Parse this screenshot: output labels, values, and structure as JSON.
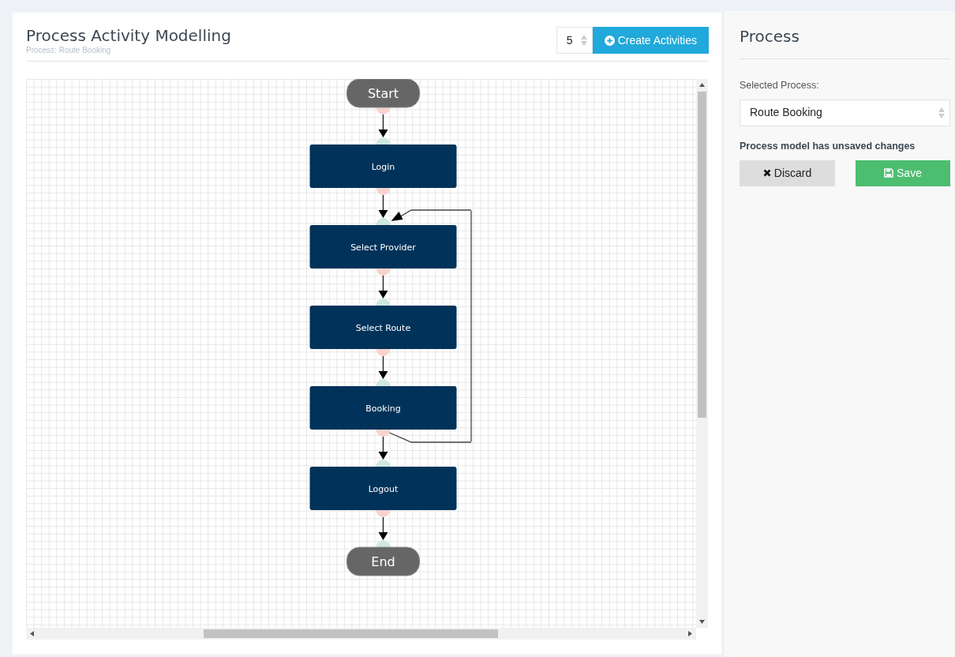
{
  "header": {
    "title": "Process Activity Modelling",
    "subtitle": "Process: Route Booking"
  },
  "toolbar": {
    "count": "5",
    "create_button": "Create Activities"
  },
  "diagram": {
    "nodes": [
      {
        "kind": "start",
        "label": "Start",
        "loop_source": false,
        "loop_target": false
      },
      {
        "kind": "activity",
        "label": "Login",
        "loop_source": false,
        "loop_target": false
      },
      {
        "kind": "activity",
        "label": "Select Provider",
        "loop_source": false,
        "loop_target": true
      },
      {
        "kind": "activity",
        "label": "Select Route",
        "loop_source": false,
        "loop_target": false
      },
      {
        "kind": "activity",
        "label": "Booking",
        "loop_source": true,
        "loop_target": false
      },
      {
        "kind": "activity",
        "label": "Logout",
        "loop_source": false,
        "loop_target": false
      },
      {
        "kind": "end",
        "label": "End",
        "loop_source": false,
        "loop_target": false
      }
    ]
  },
  "sidebar": {
    "title": "Process",
    "select_label": "Selected Process:",
    "selected_process": "Route Booking",
    "notice": "Process model has unsaved changes",
    "discard_button": "Discard",
    "save_button": "Save"
  }
}
